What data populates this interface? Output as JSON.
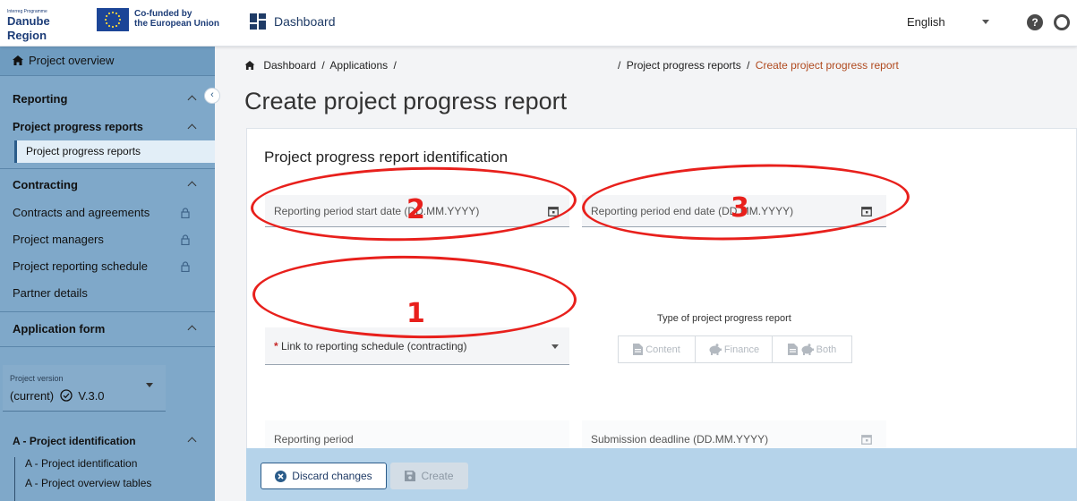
{
  "header": {
    "logo_small": "Interreg Programme",
    "logo_big": "Danube Region",
    "eu_text_line1": "Co-funded by",
    "eu_text_line2": "the European Union",
    "dashboard_label": "Dashboard",
    "language": "English"
  },
  "sidebar": {
    "project_overview": "Project overview",
    "reporting": "Reporting",
    "project_progress_reports_group": "Project progress reports",
    "project_progress_reports_item": "Project progress reports",
    "contracting": "Contracting",
    "contracts_and_agreements": "Contracts and agreements",
    "project_managers": "Project managers",
    "project_reporting_schedule": "Project reporting schedule",
    "partner_details": "Partner details",
    "application_form": "Application form",
    "version_label": "Project version",
    "version_value": "(current)",
    "version_number": "V.3.0",
    "a_project_identification_group": "A - Project identification",
    "a_project_identification_item": "A - Project identification",
    "a_project_overview_tables": "A - Project overview tables"
  },
  "breadcrumb": {
    "dashboard": "Dashboard",
    "applications": "Applications",
    "project_progress_reports": "Project progress reports",
    "current": "Create project progress report",
    "separator": "/"
  },
  "page": {
    "title": "Create project progress report",
    "section_title": "Project progress report identification"
  },
  "form": {
    "start_date_label": "Reporting period start date (DD.MM.YYYY)",
    "end_date_label": "Reporting period end date (DD.MM.YYYY)",
    "link_required_mark": "*",
    "link_label": "Link to reporting schedule (contracting)",
    "type_label": "Type of project progress report",
    "type_options": [
      "Content",
      "Finance",
      "Both"
    ],
    "reporting_period_label": "Reporting period",
    "submission_deadline_label": "Submission deadline (DD.MM.YYYY)"
  },
  "footer": {
    "discard_label": "Discard changes",
    "create_label": "Create"
  },
  "annotations": [
    "1",
    "2",
    "3"
  ],
  "colors": {
    "sidebar_bg": "#7fa8c9",
    "accent": "#2b5c8a",
    "breadcrumb_current": "#b04a1f",
    "annotation_red": "#e8201c"
  }
}
